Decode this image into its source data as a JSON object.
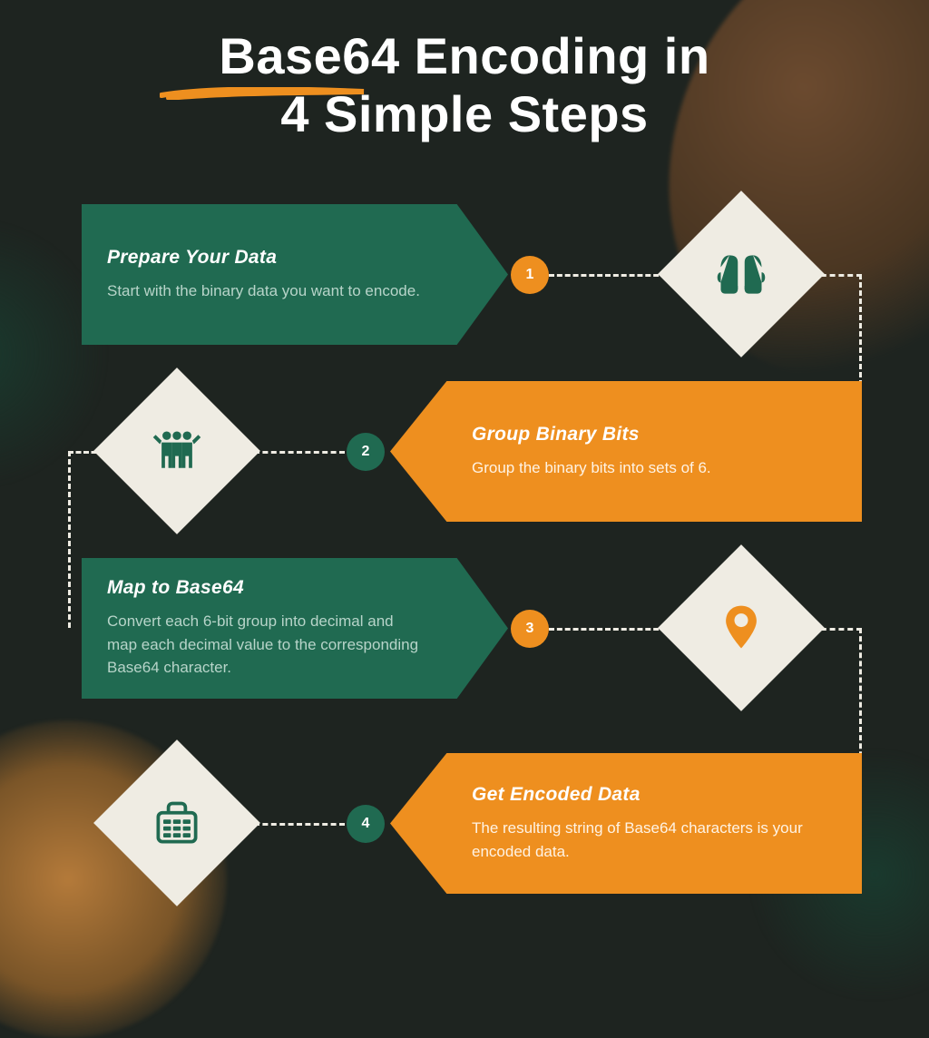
{
  "title_line1": "Base64 Encoding in",
  "title_line2": "4 Simple Steps",
  "colors": {
    "green": "#206a51",
    "orange": "#ee8f1f",
    "cream": "#efece3",
    "bg": "#1e2420"
  },
  "steps": [
    {
      "num": "1",
      "title": "Prepare Your Data",
      "body": "Start with the binary data you want to encode.",
      "icon": "mittens"
    },
    {
      "num": "2",
      "title": "Group Binary Bits",
      "body": "Group the binary bits into sets of 6.",
      "icon": "people-group"
    },
    {
      "num": "3",
      "title": "Map to Base64",
      "body": "Convert each 6-bit group into decimal and map each decimal value to the corresponding Base64 character.",
      "icon": "map-pin"
    },
    {
      "num": "4",
      "title": "Get Encoded Data",
      "body": "The resulting string of Base64 characters is your encoded data.",
      "icon": "briefcase-grid"
    }
  ]
}
